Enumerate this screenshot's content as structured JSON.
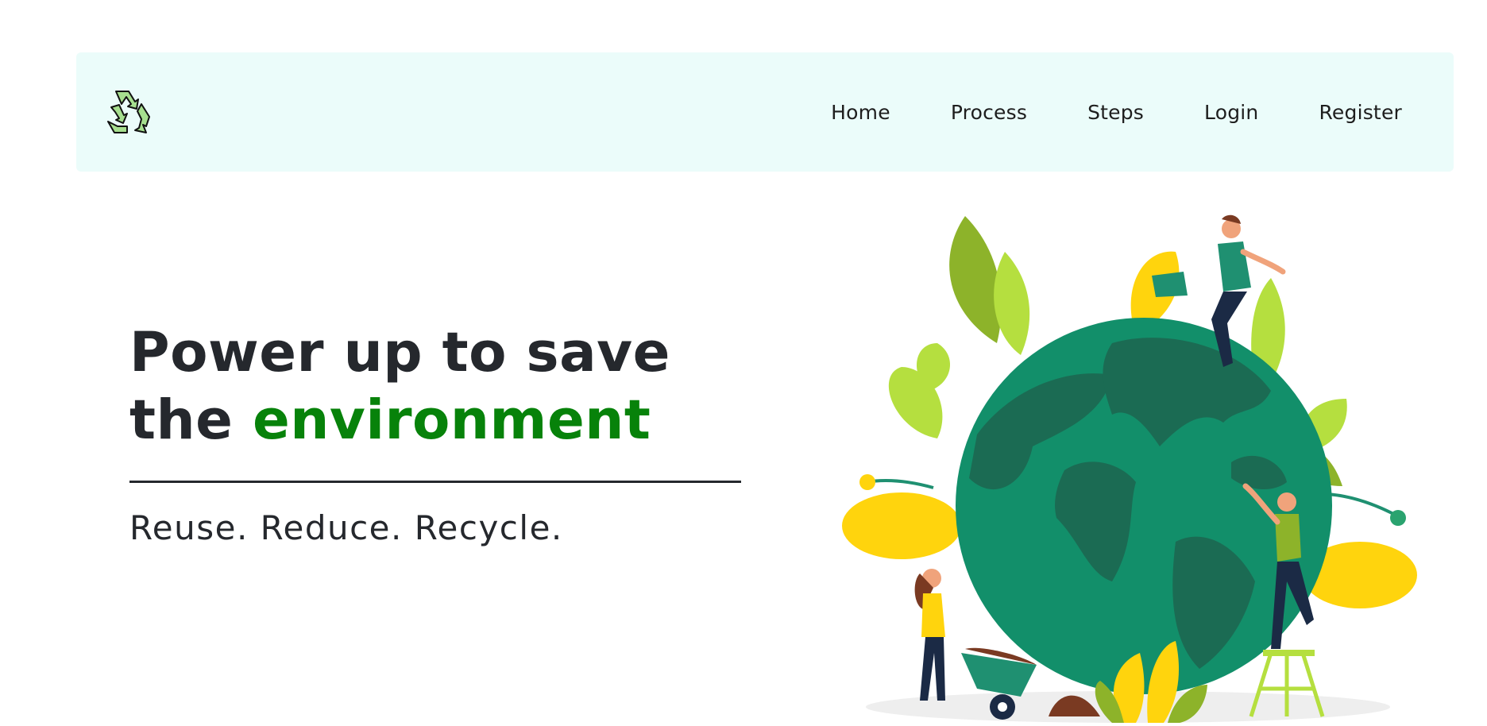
{
  "navbar": {
    "logo_icon": "recycle-icon",
    "links": [
      {
        "label": "Home"
      },
      {
        "label": "Process"
      },
      {
        "label": "Steps"
      },
      {
        "label": "Login"
      },
      {
        "label": "Register"
      }
    ],
    "background": "#ebfcfa"
  },
  "hero": {
    "headline_line1": "Power up to save",
    "headline_line2_prefix": "the ",
    "headline_accent": "environment",
    "tagline": "Reuse. Reduce. Recycle.",
    "illustration_icon": "earth-care-illustration"
  },
  "colors": {
    "text": "#25282d",
    "accent": "#07820a",
    "globe_ocean": "#128f6a",
    "globe_land": "#1b6b53",
    "leaf_lime": "#b5df3f",
    "leaf_yellow": "#ffd40d",
    "leaf_green": "#8db32a"
  }
}
